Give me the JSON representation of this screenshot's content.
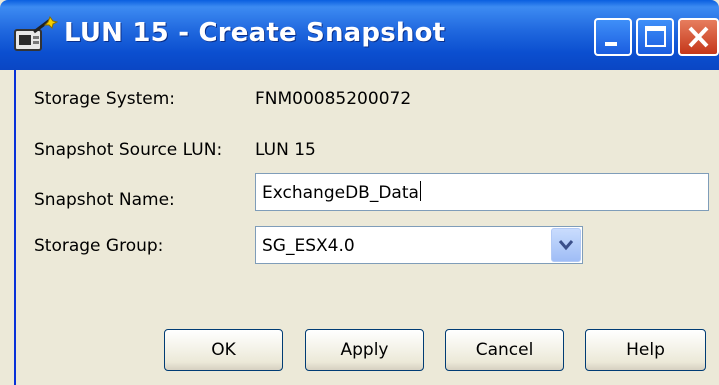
{
  "window": {
    "title": "LUN 15 - Create Snapshot",
    "icon": "snapshot-wand-icon",
    "controls": [
      "minimize-icon",
      "maximize-icon",
      "close-icon"
    ]
  },
  "form": {
    "storage_system": {
      "label": "Storage System:",
      "value": "FNM00085200072"
    },
    "source_lun": {
      "label": "Snapshot Source LUN:",
      "value": "LUN 15"
    },
    "snapshot_name": {
      "label": "Snapshot Name:",
      "value": "ExchangeDB_Data"
    },
    "storage_group": {
      "label": "Storage Group:",
      "selected": "SG_ESX4.0"
    }
  },
  "buttons": {
    "ok": "OK",
    "apply": "Apply",
    "cancel": "Cancel",
    "help": "Help"
  },
  "colors": {
    "title_bar": "#0a4fd0",
    "dialog_background": "#ece9d8",
    "close_button": "#c5371a"
  }
}
